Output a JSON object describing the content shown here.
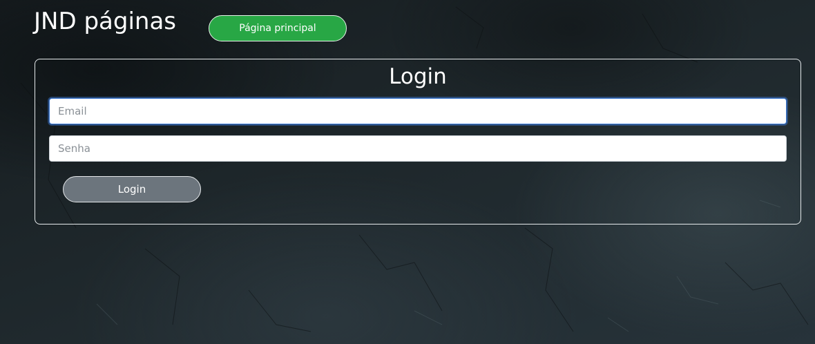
{
  "header": {
    "site_title": "JND páginas",
    "home_button_label": "Página principal",
    "home_button_color": "#28a745"
  },
  "login_form": {
    "heading": "Login",
    "email": {
      "value": "",
      "placeholder": "Email",
      "focused": true
    },
    "password": {
      "value": "",
      "placeholder": "Senha"
    },
    "submit_label": "Login",
    "submit_color": "#6c757d"
  },
  "theme": {
    "background": "#1b2226",
    "panel_border": "#e8ecee",
    "focus_ring": "#3d7bd6"
  }
}
